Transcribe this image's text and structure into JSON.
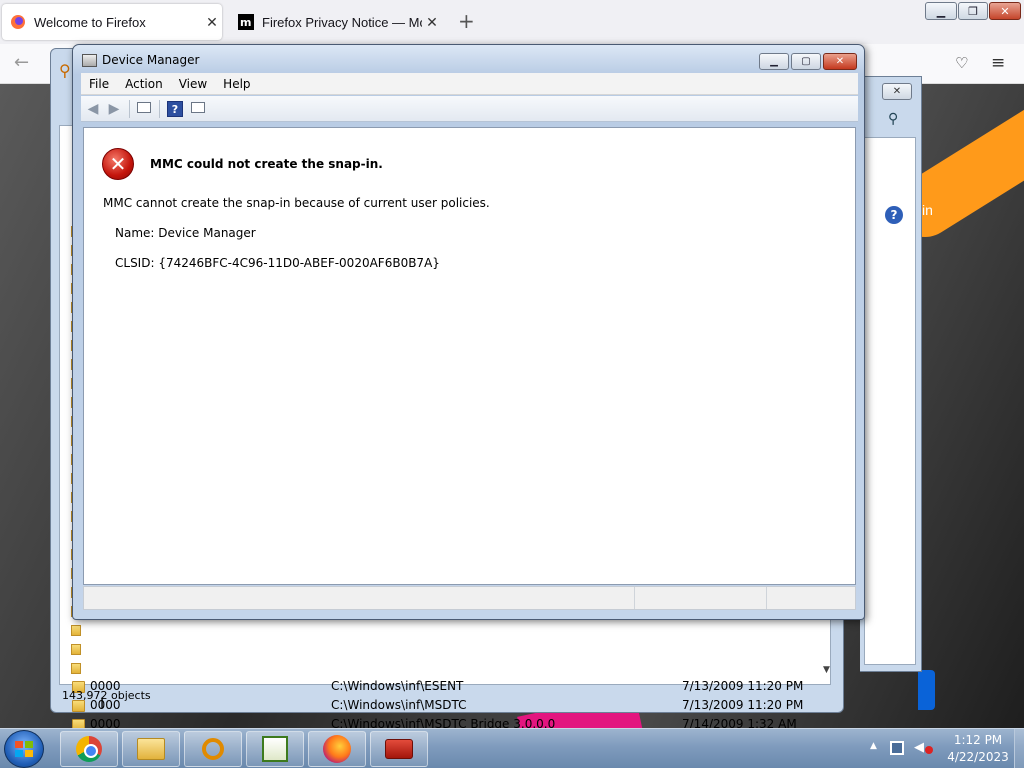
{
  "firefox": {
    "tabs": [
      {
        "label": "Welcome to Firefox",
        "icon": "firefox-icon"
      },
      {
        "label": "Firefox Privacy Notice — Mozilla",
        "icon": "mozilla-icon"
      }
    ],
    "page_partial_text": "in"
  },
  "explorer": {
    "rows": [
      {
        "name": "0000",
        "path": "C:\\Windows\\inf\\ESENT",
        "date": "7/13/2009 11:20 PM"
      },
      {
        "name": "0000",
        "path": "C:\\Windows\\inf\\MSDTC",
        "date": "7/13/2009 11:20 PM"
      },
      {
        "name": "0000",
        "path": "C:\\Windows\\inf\\MSDTC Bridge 3.0.0.0",
        "date": "7/14/2009 1:32 AM"
      }
    ],
    "status": "143,972 objects"
  },
  "device_manager": {
    "title": "Device Manager",
    "menu": [
      "File",
      "Action",
      "View",
      "Help"
    ],
    "error": {
      "title": "MMC could not create the snap-in.",
      "body": "MMC cannot create the snap-in because of current user policies.",
      "name_line": "Name: Device Manager",
      "clsid_line": "CLSID: {74246BFC-4C96-11D0-ABEF-0020AF6B0B7A}"
    }
  },
  "taskbar": {
    "apps": [
      "chrome-icon",
      "explorer-icon",
      "search-icon",
      "editor-icon",
      "firefox-icon",
      "toolbox-icon"
    ],
    "clock_time": "1:12 PM",
    "clock_date": "4/22/2023"
  },
  "colors": {
    "error_red": "#c4150c",
    "taskbar": "#7f9bbd",
    "firefox_orange": "#ff9a1a"
  }
}
